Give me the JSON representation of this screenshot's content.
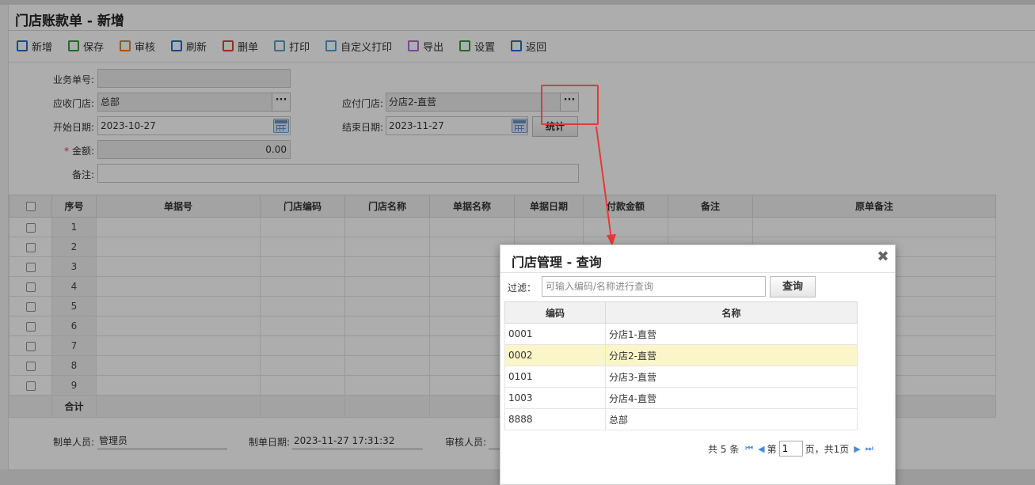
{
  "page_title": "门店账款单 - 新增",
  "toolbar": {
    "items": [
      {
        "label": "新增",
        "icon": "new-doc-icon",
        "color": "#2a6dc0"
      },
      {
        "label": "保存",
        "icon": "save-icon",
        "color": "#3a9a3a"
      },
      {
        "label": "审核",
        "icon": "approve-icon",
        "color": "#e0803a"
      },
      {
        "label": "刷新",
        "icon": "refresh-icon",
        "color": "#2a6dc0"
      },
      {
        "label": "删单",
        "icon": "delete-doc-icon",
        "color": "#d9463a"
      },
      {
        "label": "打印",
        "icon": "print-icon",
        "color": "#5a9fc6"
      },
      {
        "label": "自定义打印",
        "icon": "custom-print-icon",
        "color": "#5a9fc6"
      },
      {
        "label": "导出",
        "icon": "export-icon",
        "color": "#b36ad0"
      },
      {
        "label": "设置",
        "icon": "settings-icon",
        "color": "#3a9a3a"
      },
      {
        "label": "返回",
        "icon": "back-icon",
        "color": "#2a6dc0"
      }
    ]
  },
  "form": {
    "doc_no_label": "业务单号:",
    "doc_no_value": "",
    "recv_store_label": "应收门店:",
    "recv_store_value": "总部",
    "pay_store_label": "应付门店:",
    "pay_store_value": "分店2-直营",
    "start_date_label": "开始日期:",
    "start_date_value": "2023-10-27",
    "end_date_label": "结束日期:",
    "end_date_value": "2023-11-27",
    "stat_button": "统计",
    "required_mark": "*",
    "amount_label": "金额:",
    "amount_value": "0.00",
    "remark_label": "备注:",
    "remark_value": "",
    "dots": "···"
  },
  "grid": {
    "columns": [
      "序号",
      "单据号",
      "门店编码",
      "门店名称",
      "单据名称",
      "单据日期",
      "付款金额",
      "备注",
      "原单备注"
    ],
    "rows": [
      "1",
      "2",
      "3",
      "4",
      "5",
      "6",
      "7",
      "8",
      "9"
    ],
    "total_label": "合计"
  },
  "footer": {
    "maker_label": "制单人员:",
    "maker_value": "管理员",
    "make_date_label": "制单日期:",
    "make_date_value": "2023-11-27 17:31:32",
    "auditor_label": "审核人员:"
  },
  "dialog": {
    "title": "门店管理 - 查询",
    "close": "✖",
    "filter_label": "过滤：",
    "filter_placeholder": "可输入编码/名称进行查询",
    "query_button": "查询",
    "columns": [
      "编码",
      "名称"
    ],
    "rows": [
      {
        "code": "0001",
        "name": "分店1-直营"
      },
      {
        "code": "0002",
        "name": "分店2-直营"
      },
      {
        "code": "0101",
        "name": "分店3-直营"
      },
      {
        "code": "1003",
        "name": "分店4-直营"
      },
      {
        "code": "8888",
        "name": "总部"
      }
    ],
    "selected_index": 1,
    "pager": {
      "total_text": "共 5 条",
      "page_prefix": "第",
      "page_value": "1",
      "page_suffix": "页，共1页"
    }
  },
  "colors": {
    "annotation": "#e53935",
    "selected_row": "#fbf6c9",
    "pager_icon": "#4a8bd6"
  }
}
